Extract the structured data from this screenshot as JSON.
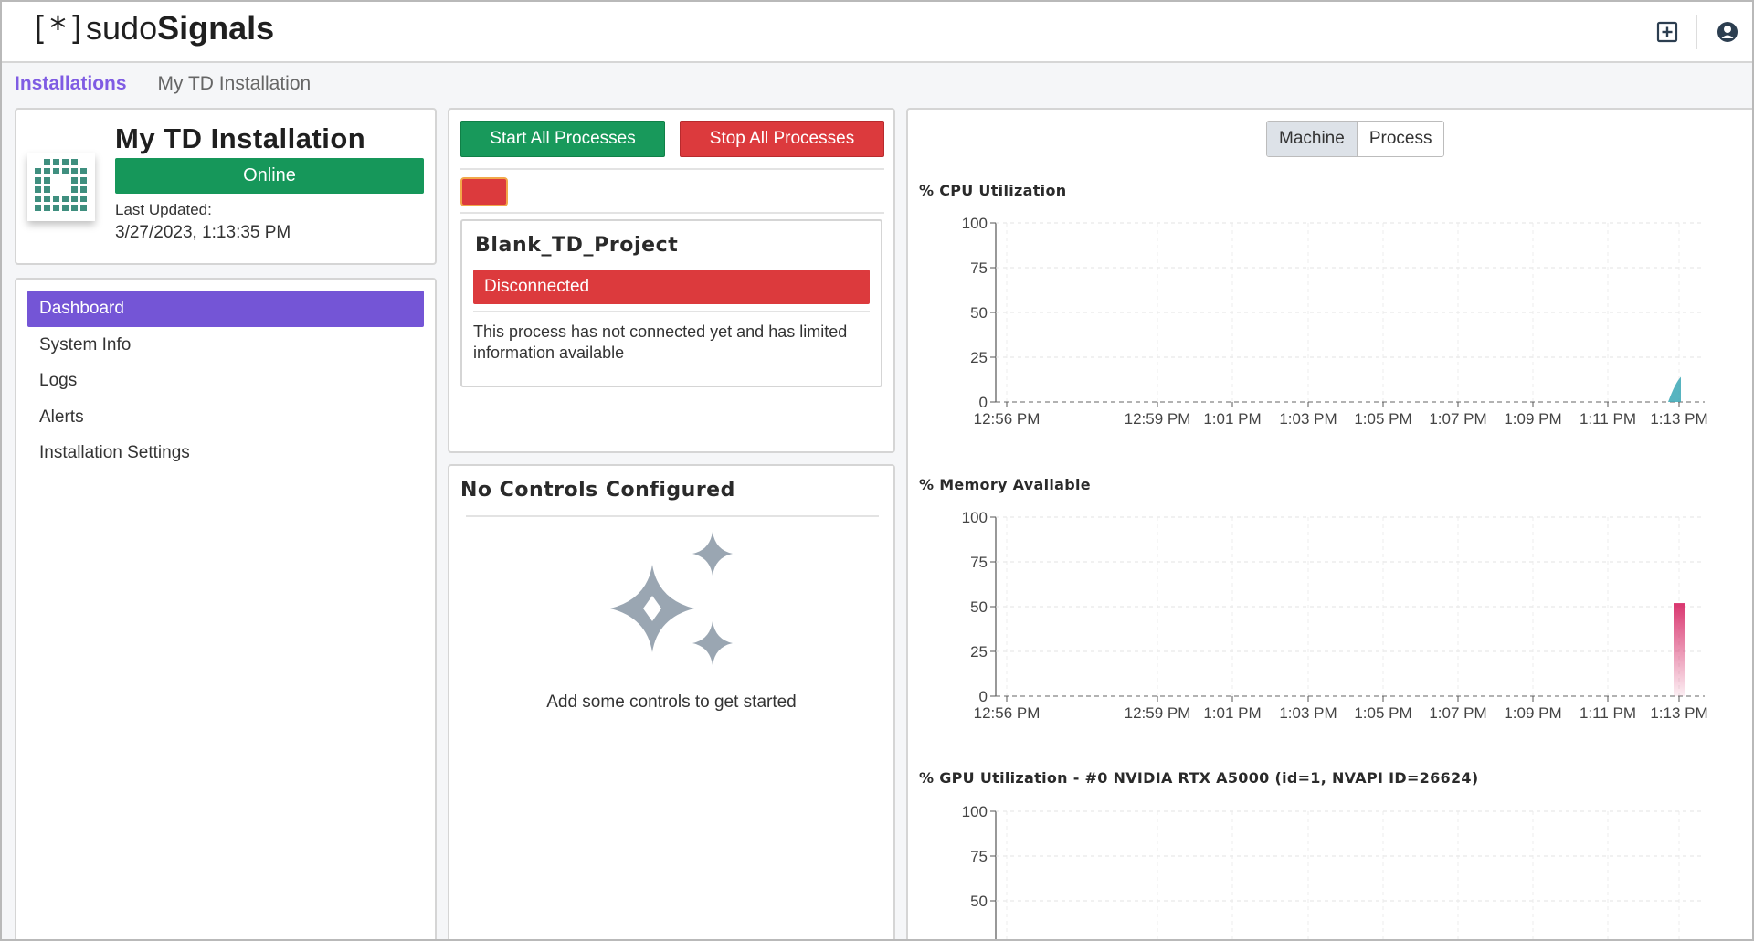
{
  "app": {
    "logo_bracket": "[*]",
    "logo_sudo": "sudo",
    "logo_signals": "Signals",
    "icons": [
      "add-window-icon",
      "user-account-icon"
    ]
  },
  "breadcrumb": {
    "link": "Installations",
    "current": "My TD Installation"
  },
  "installation": {
    "title": "My TD Installation",
    "status": "Online",
    "status_color": "#16975a",
    "last_updated_label": "Last Updated:",
    "last_updated_value": "3/27/2023, 1:13:35 PM"
  },
  "nav": {
    "items": [
      {
        "label": "Dashboard",
        "active": true
      },
      {
        "label": "System Info",
        "active": false
      },
      {
        "label": "Logs",
        "active": false
      },
      {
        "label": "Alerts",
        "active": false
      },
      {
        "label": "Installation Settings",
        "active": false
      }
    ],
    "accent": "#7455d6"
  },
  "processes": {
    "start_label": "Start All Processes",
    "stop_label": "Stop All Processes",
    "process_name": "Blank_TD_Project",
    "process_status": "Disconnected",
    "process_description": "This process has not connected yet and has limited information available"
  },
  "controls": {
    "title": "No Controls Configured",
    "empty_text": "Add some controls to get started"
  },
  "charts_toggle": {
    "options": [
      "Machine",
      "Process"
    ],
    "selected": "Machine"
  },
  "chart_data": [
    {
      "type": "area",
      "title": "% CPU Utilization",
      "x_ticks": [
        "12:56 PM",
        "12:59 PM",
        "1:01 PM",
        "1:03 PM",
        "1:05 PM",
        "1:07 PM",
        "1:09 PM",
        "1:11 PM",
        "1:13 PM"
      ],
      "y_ticks": [
        100,
        75,
        50,
        25,
        0
      ],
      "ylim": [
        0,
        100
      ],
      "grid": true,
      "series": [
        {
          "x": [
            "1:13 PM"
          ],
          "values": [
            14
          ]
        }
      ],
      "color": "#3aa7b5"
    },
    {
      "type": "bar",
      "title": "% Memory Available",
      "x_ticks": [
        "12:56 PM",
        "12:59 PM",
        "1:01 PM",
        "1:03 PM",
        "1:05 PM",
        "1:07 PM",
        "1:09 PM",
        "1:11 PM",
        "1:13 PM"
      ],
      "y_ticks": [
        100,
        75,
        50,
        25,
        0
      ],
      "ylim": [
        0,
        100
      ],
      "grid": true,
      "series": [
        {
          "x": [
            "1:13 PM"
          ],
          "values": [
            52
          ]
        }
      ],
      "color": "#d9366f"
    },
    {
      "type": "line",
      "title": "% GPU Utilization - #0 NVIDIA RTX A5000 (id=1, NVAPI ID=26624)",
      "x_ticks": [],
      "y_ticks": [
        100,
        75,
        50
      ],
      "ylim": [
        0,
        100
      ],
      "grid": true,
      "series": []
    }
  ]
}
